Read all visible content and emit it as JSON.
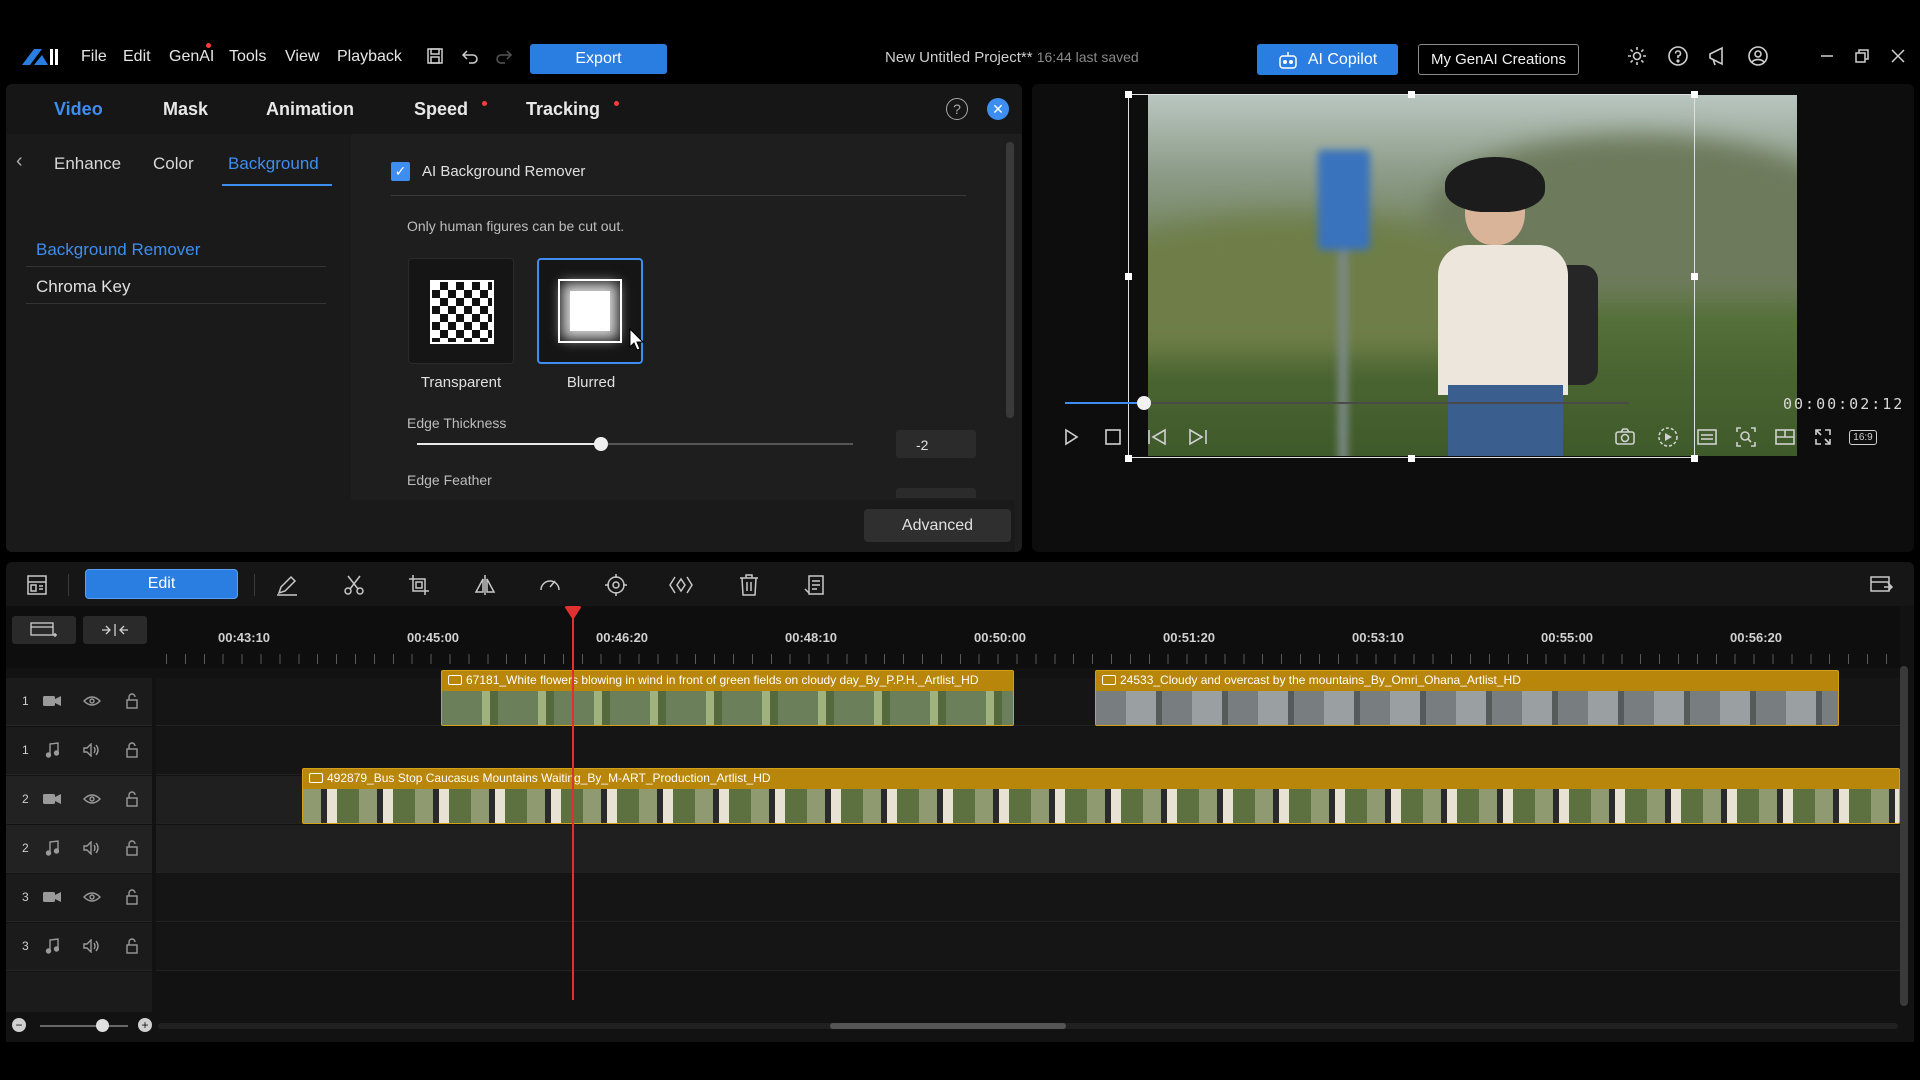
{
  "menubar": {
    "items": [
      "File",
      "Edit",
      "GenAI",
      "Tools",
      "View",
      "Playback"
    ],
    "export_label": "Export",
    "project_title": "New Untitled Project**",
    "last_saved": "16:44 last saved",
    "copilot_label": "AI Copilot",
    "genai_creations_label": "My GenAI Creations"
  },
  "prop_panel": {
    "tabs": [
      "Video",
      "Mask",
      "Animation",
      "Speed",
      "Tracking"
    ],
    "active_tab": "Video",
    "help_glyph": "?",
    "close_glyph": "✕",
    "back_glyph": "‹",
    "subtabs": [
      "Enhance",
      "Color",
      "Background"
    ],
    "active_subtab": "Background",
    "side_items": [
      "Background Remover",
      "Chroma Key"
    ],
    "active_side_item": "Background Remover",
    "checkbox_label": "AI Background Remover",
    "checkbox_checked": true,
    "note": "Only human figures can be cut out.",
    "options": [
      "Transparent",
      "Blurred"
    ],
    "selected_option": "Blurred",
    "edge_thickness_label": "Edge Thickness",
    "edge_thickness_value": "-2",
    "edge_feather_label": "Edge Feather",
    "advanced_label": "Advanced"
  },
  "preview": {
    "timecode": "00:00:02:12",
    "aspect_label": "16:9",
    "playback_progress": 0.14
  },
  "timeline_toolbar": {
    "edit_label": "Edit"
  },
  "timeline": {
    "ruler_labels": [
      "00:43:10",
      "00:45:00",
      "00:46:20",
      "00:48:10",
      "00:50:00",
      "00:51:20",
      "00:53:10",
      "00:55:00",
      "00:56:20"
    ],
    "tracks": [
      {
        "num": "1",
        "type": "video"
      },
      {
        "num": "1",
        "type": "audio"
      },
      {
        "num": "2",
        "type": "video"
      },
      {
        "num": "2",
        "type": "audio"
      },
      {
        "num": "3",
        "type": "video"
      },
      {
        "num": "3",
        "type": "audio"
      }
    ],
    "clips": {
      "c1": "67181_White flowers blowing in wind in front of green fields on cloudy day_By_P.P.H._Artlist_HD",
      "c2": "24533_Cloudy and overcast by the mountains_By_Omri_Ohana_Artlist_HD",
      "c3": "492879_Bus Stop Caucasus Mountains Waiting_By_M-ART_Production_Artlist_HD"
    },
    "zoom_minus": "−",
    "zoom_plus": "+"
  },
  "colors": {
    "accent": "#2a7de1",
    "active_text": "#3d8ef0",
    "clip": "#b8860b",
    "playhead": "#e03030"
  }
}
